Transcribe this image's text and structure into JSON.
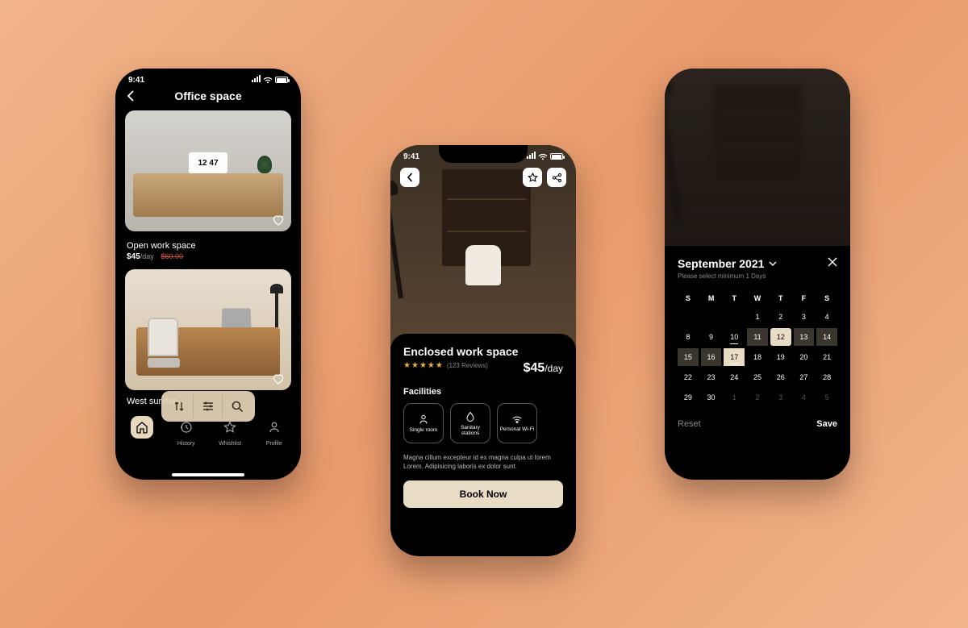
{
  "status": {
    "time": "9:41"
  },
  "screen1": {
    "title": "Office space",
    "clock": "12 47",
    "cards": [
      {
        "name": "Open work space",
        "price": "$45",
        "per": "/day",
        "old": "$60.00"
      },
      {
        "name": "West sunrise"
      }
    ],
    "nav": [
      "Home",
      "History",
      "Whishlist",
      "Profile"
    ]
  },
  "screen2": {
    "title": "Enclosed work space",
    "reviews": "(123 Reviews)",
    "price": "$45",
    "per": "/day",
    "fac_title": "Facilities",
    "facilities": [
      "Single room",
      "Sanitary stations",
      "Personal Wi-Fi"
    ],
    "desc": "Magna cillum excepteur id ex magna culpa ut lorem Lorem. Adipisicing laboris ex dolor sunt.",
    "book": "Book Now"
  },
  "screen3": {
    "month": "September 2021",
    "hint": "Please select minimum 1 Days",
    "dow": [
      "S",
      "M",
      "T",
      "W",
      "T",
      "F",
      "S"
    ],
    "weeks": [
      [
        {
          "d": ""
        },
        {
          "d": ""
        },
        {
          "d": ""
        },
        {
          "d": "1"
        },
        {
          "d": "2"
        },
        {
          "d": "3"
        },
        {
          "d": "4"
        }
      ],
      [
        {
          "d": "8"
        },
        {
          "d": "9"
        },
        {
          "d": "10",
          "und": true
        },
        {
          "d": "11",
          "sel": "mid"
        },
        {
          "d": "12",
          "sel": "start"
        },
        {
          "d": "13",
          "sel": "mid"
        },
        {
          "d": "14",
          "sel": "mid"
        }
      ],
      [
        {
          "d": "15",
          "sel": "mid"
        },
        {
          "d": "16",
          "sel": "mid"
        },
        {
          "d": "17",
          "sel": "end",
          "und": true
        },
        {
          "d": "18"
        },
        {
          "d": "19"
        },
        {
          "d": "20"
        },
        {
          "d": "21"
        }
      ],
      [
        {
          "d": "22"
        },
        {
          "d": "23"
        },
        {
          "d": "24"
        },
        {
          "d": "25"
        },
        {
          "d": "26"
        },
        {
          "d": "27"
        },
        {
          "d": "28"
        }
      ],
      [
        {
          "d": "29"
        },
        {
          "d": "30"
        },
        {
          "d": "1",
          "dim": true
        },
        {
          "d": "2",
          "dim": true
        },
        {
          "d": "3",
          "dim": true
        },
        {
          "d": "4",
          "dim": true
        },
        {
          "d": "5",
          "dim": true
        }
      ]
    ],
    "reset": "Reset",
    "save": "Save"
  }
}
